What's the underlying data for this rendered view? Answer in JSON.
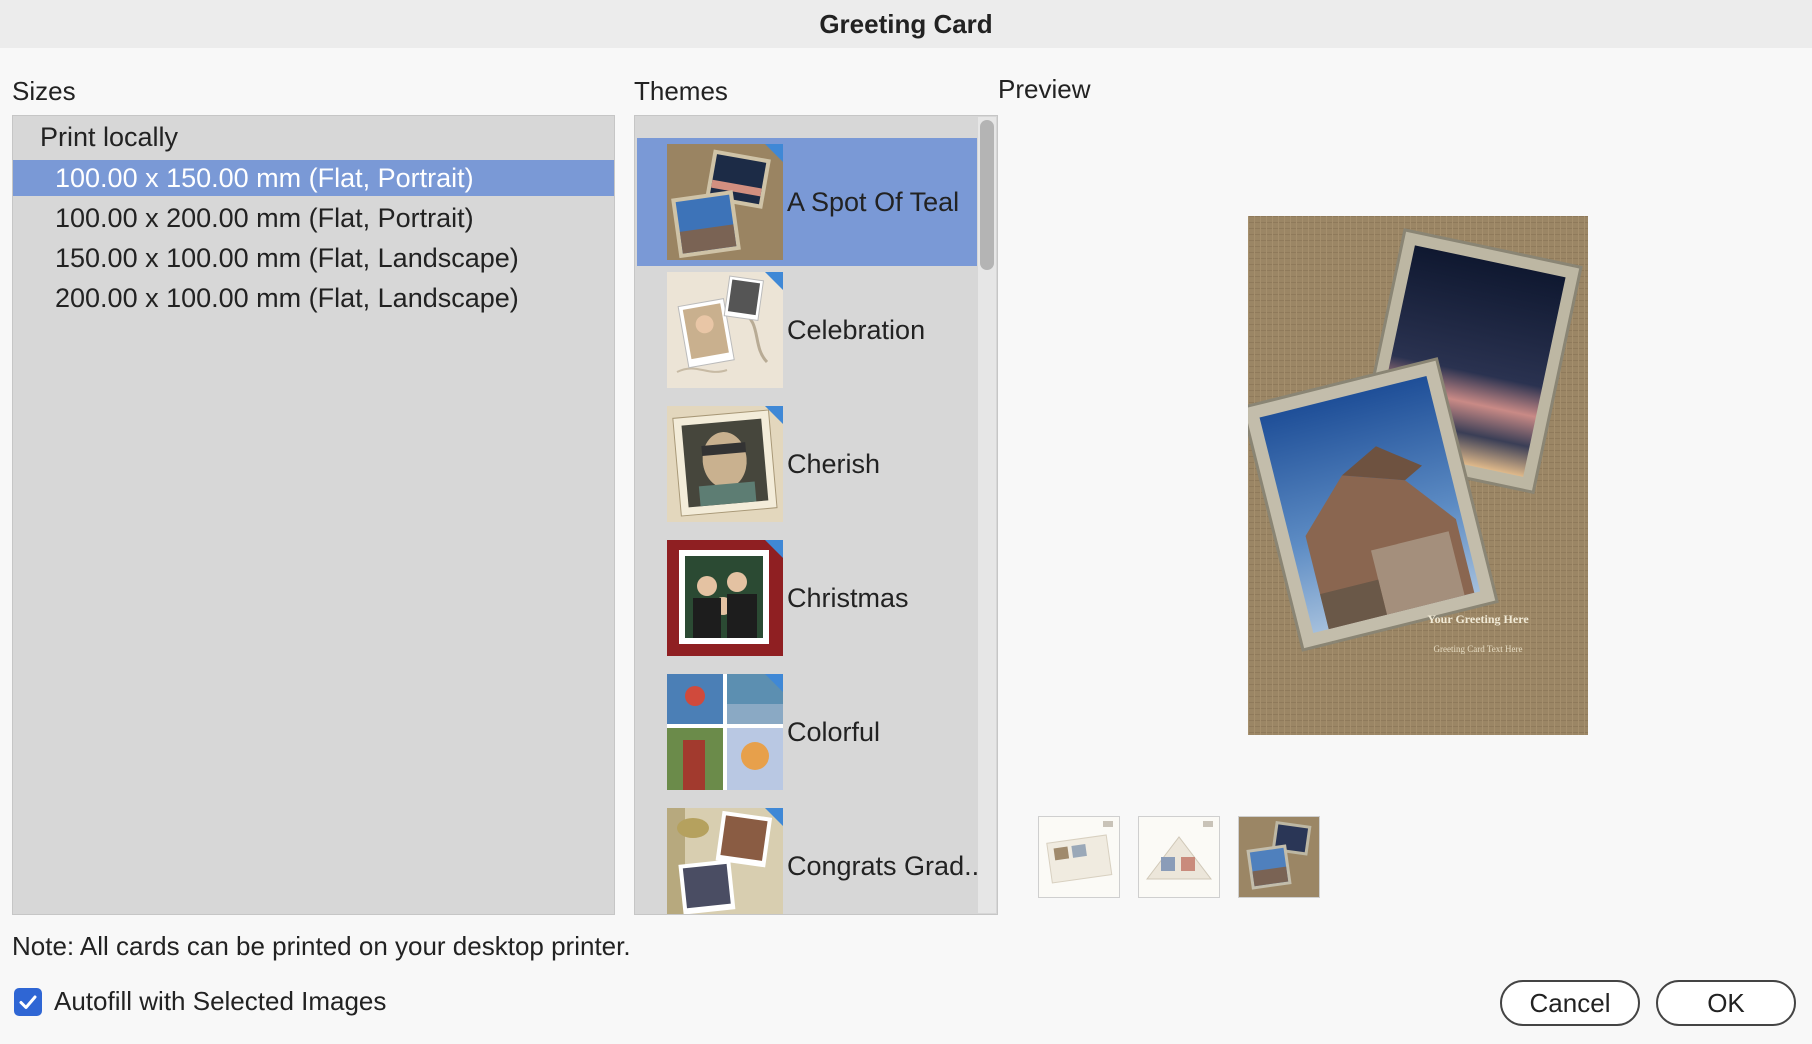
{
  "window": {
    "title": "Greeting Card"
  },
  "sizes": {
    "label": "Sizes",
    "group": "Print locally",
    "items": [
      {
        "label": "100.00 x 150.00 mm (Flat, Portrait)",
        "selected": true
      },
      {
        "label": "100.00 x 200.00 mm (Flat, Portrait)",
        "selected": false
      },
      {
        "label": "150.00 x 100.00 mm (Flat, Landscape)",
        "selected": false
      },
      {
        "label": "200.00 x 100.00 mm (Flat, Landscape)",
        "selected": false
      }
    ]
  },
  "themes": {
    "label": "Themes",
    "items": [
      {
        "label": "A Spot Of Teal",
        "selected": true
      },
      {
        "label": "Celebration",
        "selected": false
      },
      {
        "label": "Cherish",
        "selected": false
      },
      {
        "label": "Christmas",
        "selected": false
      },
      {
        "label": "Colorful",
        "selected": false
      },
      {
        "label": "Congrats Grad...",
        "selected": false
      }
    ]
  },
  "preview": {
    "label": "Preview",
    "greeting": "Your Greeting Here",
    "card_text": "Greeting Card Text Here"
  },
  "note": "Note: All cards can be printed on your desktop printer.",
  "autofill": {
    "label": "Autofill with Selected Images",
    "checked": true
  },
  "buttons": {
    "cancel": "Cancel",
    "ok": "OK"
  },
  "colors": {
    "selection": "#7a99d6",
    "checkbox": "#2f66d4",
    "theme_corner": "#3f88d6"
  }
}
